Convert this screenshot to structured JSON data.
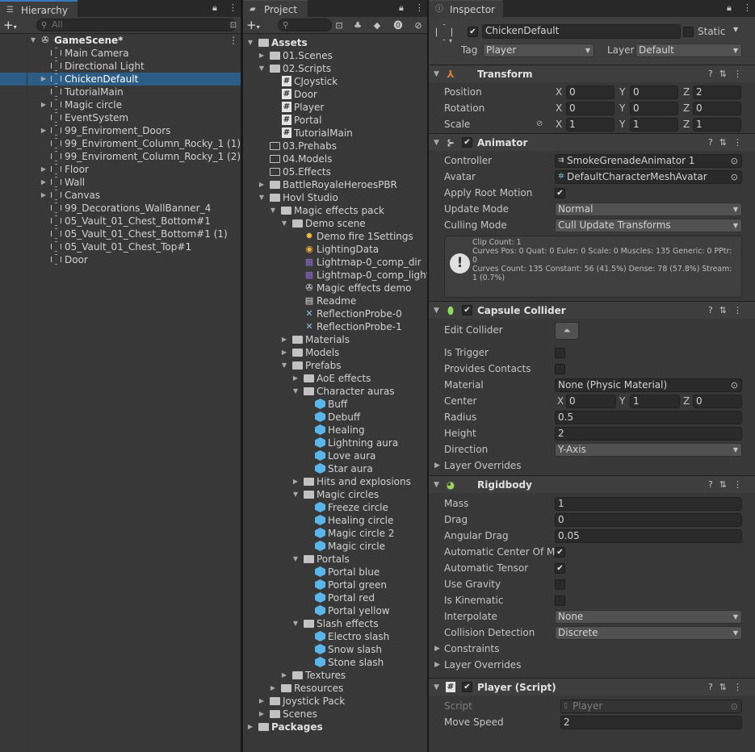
{
  "hierarchy": {
    "tab_label": "Hierarchy",
    "search_placeholder": "All",
    "scene": "GameScene*",
    "items": [
      {
        "label": "Main Camera",
        "indent": 2,
        "arrow": false
      },
      {
        "label": "Directional Light",
        "indent": 2,
        "arrow": false
      },
      {
        "label": "ChickenDefault",
        "indent": 2,
        "arrow": true,
        "selected": true
      },
      {
        "label": "TutorialMain",
        "indent": 2,
        "arrow": false
      },
      {
        "label": "Magic circle",
        "indent": 2,
        "arrow": true
      },
      {
        "label": "EventSystem",
        "indent": 2,
        "arrow": false
      },
      {
        "label": "99_Enviroment_Doors",
        "indent": 2,
        "arrow": true
      },
      {
        "label": "99_Enviroment_Column_Rocky_1 (1)",
        "indent": 2,
        "arrow": false
      },
      {
        "label": "99_Enviroment_Column_Rocky_1 (2)",
        "indent": 2,
        "arrow": false
      },
      {
        "label": "Floor",
        "indent": 2,
        "arrow": true
      },
      {
        "label": "Wall",
        "indent": 2,
        "arrow": true
      },
      {
        "label": "Canvas",
        "indent": 2,
        "arrow": true
      },
      {
        "label": "99_Decorations_WallBanner_4",
        "indent": 2,
        "arrow": false
      },
      {
        "label": "05_Vault_01_Chest_Bottom#1",
        "indent": 2,
        "arrow": false
      },
      {
        "label": "05_Vault_01_Chest_Bottom#1 (1)",
        "indent": 2,
        "arrow": false
      },
      {
        "label": "05_Vault_01_Chest_Top#1",
        "indent": 2,
        "arrow": false
      },
      {
        "label": "Door",
        "indent": 2,
        "arrow": false
      }
    ]
  },
  "project": {
    "tab_label": "Project",
    "items": [
      {
        "label": "Assets",
        "d": 0,
        "a": "open",
        "t": "folder",
        "bold": true
      },
      {
        "label": "01.Scenes",
        "d": 1,
        "a": "closed",
        "t": "folder"
      },
      {
        "label": "02.Scripts",
        "d": 1,
        "a": "open",
        "t": "folder"
      },
      {
        "label": "CJoystick",
        "d": 2,
        "a": "",
        "t": "script"
      },
      {
        "label": "Door",
        "d": 2,
        "a": "",
        "t": "script"
      },
      {
        "label": "Player",
        "d": 2,
        "a": "",
        "t": "script"
      },
      {
        "label": "Portal",
        "d": 2,
        "a": "",
        "t": "script"
      },
      {
        "label": "TutorialMain",
        "d": 2,
        "a": "",
        "t": "script"
      },
      {
        "label": "03.Prehabs",
        "d": 1,
        "a": "",
        "t": "folder-empty"
      },
      {
        "label": "04.Models",
        "d": 1,
        "a": "",
        "t": "folder-empty"
      },
      {
        "label": "05.Effects",
        "d": 1,
        "a": "",
        "t": "folder-empty"
      },
      {
        "label": "BattleRoyaleHeroesPBR",
        "d": 1,
        "a": "closed",
        "t": "folder"
      },
      {
        "label": "Hovl Studio",
        "d": 1,
        "a": "open",
        "t": "folder"
      },
      {
        "label": "Magic effects pack",
        "d": 2,
        "a": "open",
        "t": "folder"
      },
      {
        "label": "Demo scene",
        "d": 3,
        "a": "open",
        "t": "folder"
      },
      {
        "label": "Demo fire 1Settings",
        "d": 4,
        "a": "",
        "t": "settings"
      },
      {
        "label": "LightingData",
        "d": 4,
        "a": "",
        "t": "lighting"
      },
      {
        "label": "Lightmap-0_comp_dir",
        "d": 4,
        "a": "",
        "t": "lightmap"
      },
      {
        "label": "Lightmap-0_comp_light",
        "d": 4,
        "a": "",
        "t": "lightmap"
      },
      {
        "label": "Magic effects demo",
        "d": 4,
        "a": "",
        "t": "unity"
      },
      {
        "label": "Readme",
        "d": 4,
        "a": "",
        "t": "doc"
      },
      {
        "label": "ReflectionProbe-0",
        "d": 4,
        "a": "",
        "t": "probe"
      },
      {
        "label": "ReflectionProbe-1",
        "d": 4,
        "a": "",
        "t": "probe"
      },
      {
        "label": "Materials",
        "d": 3,
        "a": "closed",
        "t": "folder"
      },
      {
        "label": "Models",
        "d": 3,
        "a": "closed",
        "t": "folder"
      },
      {
        "label": "Prefabs",
        "d": 3,
        "a": "open",
        "t": "folder"
      },
      {
        "label": "AoE effects",
        "d": 4,
        "a": "closed",
        "t": "folder"
      },
      {
        "label": "Character auras",
        "d": 4,
        "a": "open",
        "t": "folder"
      },
      {
        "label": "Buff",
        "d": 5,
        "a": "",
        "t": "prefab"
      },
      {
        "label": "Debuff",
        "d": 5,
        "a": "",
        "t": "prefab"
      },
      {
        "label": "Healing",
        "d": 5,
        "a": "",
        "t": "prefab"
      },
      {
        "label": "Lightning aura",
        "d": 5,
        "a": "",
        "t": "prefab"
      },
      {
        "label": "Love aura",
        "d": 5,
        "a": "",
        "t": "prefab"
      },
      {
        "label": "Star aura",
        "d": 5,
        "a": "",
        "t": "prefab"
      },
      {
        "label": "Hits and explosions",
        "d": 4,
        "a": "closed",
        "t": "folder"
      },
      {
        "label": "Magic circles",
        "d": 4,
        "a": "open",
        "t": "folder"
      },
      {
        "label": "Freeze circle",
        "d": 5,
        "a": "",
        "t": "prefab"
      },
      {
        "label": "Healing circle",
        "d": 5,
        "a": "",
        "t": "prefab"
      },
      {
        "label": "Magic circle 2",
        "d": 5,
        "a": "",
        "t": "prefab"
      },
      {
        "label": "Magic circle",
        "d": 5,
        "a": "",
        "t": "prefab"
      },
      {
        "label": "Portals",
        "d": 4,
        "a": "open",
        "t": "folder"
      },
      {
        "label": "Portal blue",
        "d": 5,
        "a": "",
        "t": "prefab"
      },
      {
        "label": "Portal green",
        "d": 5,
        "a": "",
        "t": "prefab"
      },
      {
        "label": "Portal red",
        "d": 5,
        "a": "",
        "t": "prefab"
      },
      {
        "label": "Portal yellow",
        "d": 5,
        "a": "",
        "t": "prefab"
      },
      {
        "label": "Slash effects",
        "d": 4,
        "a": "open",
        "t": "folder"
      },
      {
        "label": "Electro slash",
        "d": 5,
        "a": "",
        "t": "prefab"
      },
      {
        "label": "Snow slash",
        "d": 5,
        "a": "",
        "t": "prefab"
      },
      {
        "label": "Stone slash",
        "d": 5,
        "a": "",
        "t": "prefab"
      },
      {
        "label": "Textures",
        "d": 3,
        "a": "closed",
        "t": "folder"
      },
      {
        "label": "Resources",
        "d": 2,
        "a": "closed",
        "t": "folder"
      },
      {
        "label": "Joystick Pack",
        "d": 1,
        "a": "closed",
        "t": "folder"
      },
      {
        "label": "Scenes",
        "d": 1,
        "a": "closed",
        "t": "folder"
      },
      {
        "label": "Packages",
        "d": 0,
        "a": "closed",
        "t": "folder",
        "bold": true
      }
    ]
  },
  "inspector": {
    "tab_label": "Inspector",
    "object_name": "ChickenDefault",
    "static_label": "Static",
    "tag_label": "Tag",
    "tag_value": "Player",
    "layer_label": "Layer",
    "layer_value": "Default",
    "transform": {
      "title": "Transform",
      "position_label": "Position",
      "position": [
        "0",
        "0",
        "2"
      ],
      "rotation_label": "Rotation",
      "rotation": [
        "0",
        "0",
        "0"
      ],
      "scale_label": "Scale",
      "scale": [
        "1",
        "1",
        "1"
      ]
    },
    "animator": {
      "title": "Animator",
      "controller_label": "Controller",
      "controller": "SmokeGrenadeAnimator 1",
      "avatar_label": "Avatar",
      "avatar": "DefaultCharacterMeshAvatar",
      "root_motion_label": "Apply Root Motion",
      "update_mode_label": "Update Mode",
      "update_mode": "Normal",
      "culling_mode_label": "Culling Mode",
      "culling_mode": "Cull Update Transforms",
      "info_lines": [
        "Clip Count: 1",
        "Curves Pos: 0 Quat: 0 Euler: 0 Scale: 0 Muscles: 135 Generic: 0 PPtr: 0",
        "Curves Count: 135 Constant: 56 (41.5%) Dense: 78 (57.8%) Stream: 1 (0.7%)"
      ]
    },
    "capsule": {
      "title": "Capsule Collider",
      "edit_label": "Edit Collider",
      "trigger_label": "Is Trigger",
      "contacts_label": "Provides Contacts",
      "material_label": "Material",
      "material": "None (Physic Material)",
      "center_label": "Center",
      "center": [
        "0",
        "1",
        "0"
      ],
      "radius_label": "Radius",
      "radius": "0.5",
      "height_label": "Height",
      "height": "2",
      "direction_label": "Direction",
      "direction": "Y-Axis",
      "overrides_label": "Layer Overrides"
    },
    "rigidbody": {
      "title": "Rigidbody",
      "mass_label": "Mass",
      "mass": "1",
      "drag_label": "Drag",
      "drag": "0",
      "angular_label": "Angular Drag",
      "angular": "0.05",
      "auto_center_label": "Automatic Center Of Ma",
      "auto_tensor_label": "Automatic Tensor",
      "gravity_label": "Use Gravity",
      "kinematic_label": "Is Kinematic",
      "interpolate_label": "Interpolate",
      "interpolate": "None",
      "collision_label": "Collision Detection",
      "collision": "Discrete",
      "constraints_label": "Constraints",
      "overrides_label": "Layer Overrides"
    },
    "player_script": {
      "title": "Player (Script)",
      "script_label": "Script",
      "script": "Player",
      "speed_label": "Move Speed",
      "speed": "2"
    }
  }
}
